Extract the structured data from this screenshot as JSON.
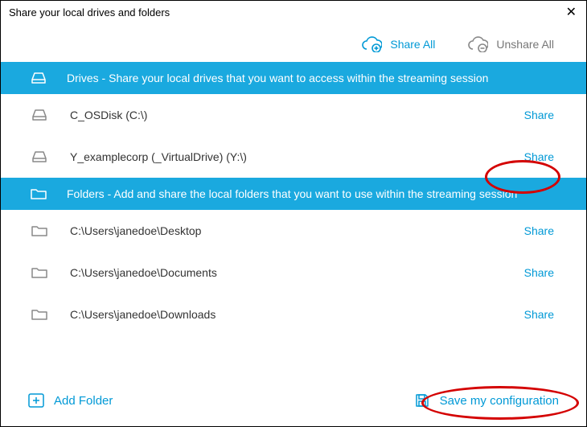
{
  "title": "Share your local drives and folders",
  "toolbar": {
    "share_all": "Share All",
    "unshare_all": "Unshare All"
  },
  "sections": {
    "drives": {
      "header": "Drives - Share your local drives that you want to access within the streaming session",
      "items": [
        {
          "label": "C_OSDisk (C:\\)",
          "action": "Share"
        },
        {
          "label": "Y_examplecorp (_VirtualDrive) (Y:\\)",
          "action": "Share"
        }
      ]
    },
    "folders": {
      "header": "Folders - Add and share the local folders that you want to use within the streaming session",
      "items": [
        {
          "label": "C:\\Users\\janedoe\\Desktop",
          "action": "Share"
        },
        {
          "label": "C:\\Users\\janedoe\\Documents",
          "action": "Share"
        },
        {
          "label": "C:\\Users\\janedoe\\Downloads",
          "action": "Share"
        }
      ]
    }
  },
  "footer": {
    "add_folder": "Add Folder",
    "save_config": "Save my configuration"
  }
}
